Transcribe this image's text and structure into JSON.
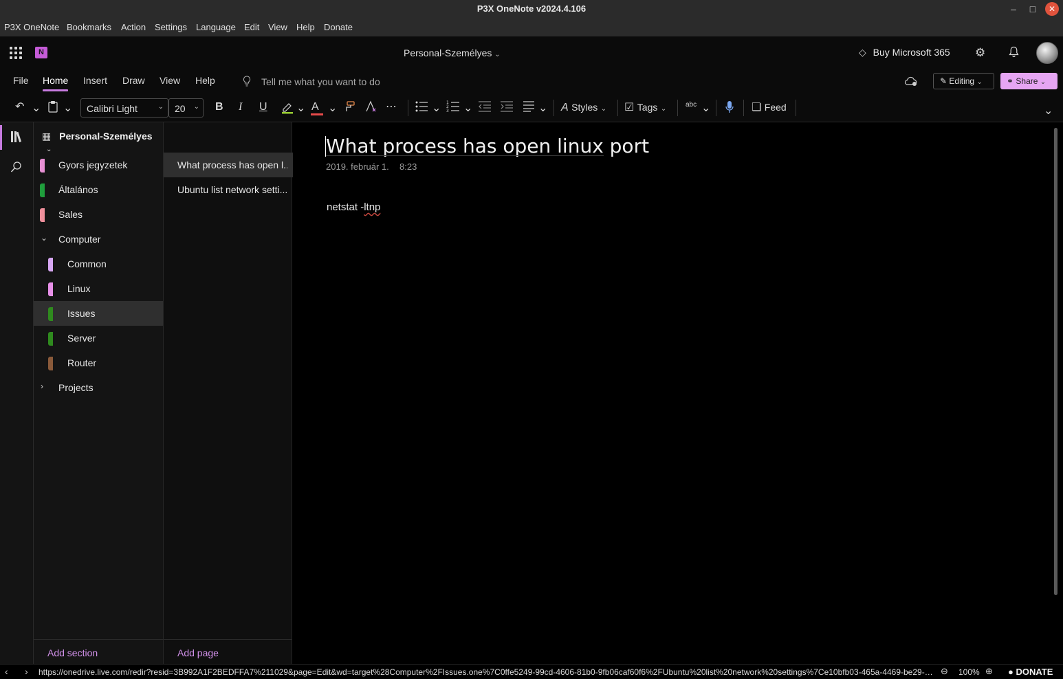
{
  "window": {
    "title": "P3X OneNote v2024.4.106",
    "minimize_glyph": "–",
    "maximize_glyph": "□",
    "close_glyph": "✕"
  },
  "app_menu": [
    "P3X OneNote",
    "Bookmarks",
    "Action",
    "Settings",
    "Language",
    "Edit",
    "View",
    "Help",
    "Donate"
  ],
  "header": {
    "logo_letter": "N",
    "notebook_title": "Personal-Személyes",
    "buy_label": "Buy Microsoft 365"
  },
  "ribbon_tabs": [
    "File",
    "Home",
    "Insert",
    "Draw",
    "View",
    "Help"
  ],
  "active_tab": "Home",
  "tell_me_placeholder": "Tell me what you want to do",
  "editing_label": "Editing",
  "share_label": "Share",
  "toolbar": {
    "font_name": "Calibri Light",
    "font_size": "20",
    "bold": "B",
    "italic": "I",
    "underline": "U",
    "font_color_glyph": "A",
    "styles_label": "Styles",
    "tags_label": "Tags",
    "spell_label": "abc",
    "feed_label": "Feed"
  },
  "notebook_name": "Personal-Személyes",
  "sections": [
    {
      "label": "Gyors jegyzetek",
      "color": "#e790d4"
    },
    {
      "label": "Általános",
      "color": "#1f9e3c"
    },
    {
      "label": "Sales",
      "color": "#f0909c"
    },
    {
      "label": "Computer",
      "expanded": true
    },
    {
      "label": "Common",
      "color": "#d7a7f3"
    },
    {
      "label": "Linux",
      "color": "#e790e8"
    },
    {
      "label": "Issues",
      "color": "#2f8a1e",
      "selected": true
    },
    {
      "label": "Server",
      "color": "#2f8a1e"
    },
    {
      "label": "Router",
      "color": "#8a5a3a"
    },
    {
      "label": "Projects",
      "expanded": false
    }
  ],
  "pages": [
    {
      "label": "What process has open l...",
      "selected": true
    },
    {
      "label": "Ubuntu list network setti..."
    }
  ],
  "add_section_label": "Add section",
  "add_page_label": "Add page",
  "page": {
    "title": "What process has open linux port",
    "date": "2019. február 1.",
    "time": "8:23",
    "body_prefix": "netstat -",
    "body_squiggled": "ltnp"
  },
  "status": {
    "url": "https://onedrive.live.com/redir?resid=3B992A1F2BEDFFA7%211029&page=Edit&wd=target%28Computer%2FIssues.one%7C0ffe5249-99cd-4606-81b0-9fb06caf60f6%2FUbuntu%20list%20network%20settings%7Ce10bfb03-465a-4469-be29-7af9...",
    "zoom": "100%",
    "donate_label": "DONATE"
  },
  "colors": {
    "accent": "#c77be0",
    "share_bg": "#e6a5f3",
    "close_button": "#e0533d"
  }
}
